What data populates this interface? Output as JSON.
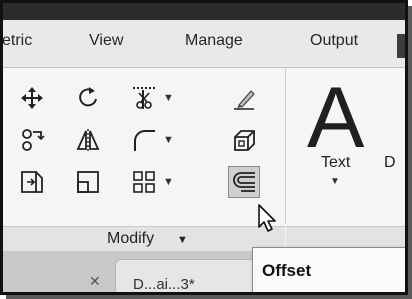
{
  "ribbon_tabs": [
    "etric",
    "View",
    "Manage",
    "Output"
  ],
  "panel": {
    "label": "Modify"
  },
  "text_tool": {
    "label": "Text",
    "big_glyph": "A",
    "partial_next_label": "D"
  },
  "tooltip": {
    "title": "Offset"
  },
  "doc_tab": {
    "text": "D...ai...3*"
  },
  "tools": [
    {
      "name": "move-icon",
      "interactable": true
    },
    {
      "name": "rotate-icon",
      "interactable": true
    },
    {
      "name": "trim-icon",
      "interactable": true,
      "dropdown": true
    },
    {
      "name": "erase-icon",
      "interactable": true
    },
    {
      "name": "copy-icon",
      "interactable": true
    },
    {
      "name": "mirror-icon",
      "interactable": true
    },
    {
      "name": "fillet-icon",
      "interactable": true,
      "dropdown": true
    },
    {
      "name": "explode-icon",
      "interactable": true
    },
    {
      "name": "stretch-icon",
      "interactable": true
    },
    {
      "name": "scale-icon",
      "interactable": true
    },
    {
      "name": "array-icon",
      "interactable": true,
      "dropdown": true
    },
    {
      "name": "offset-icon",
      "interactable": true,
      "highlighted": true
    }
  ],
  "glyphs": {
    "dropdown": "▼",
    "close": "✕"
  }
}
